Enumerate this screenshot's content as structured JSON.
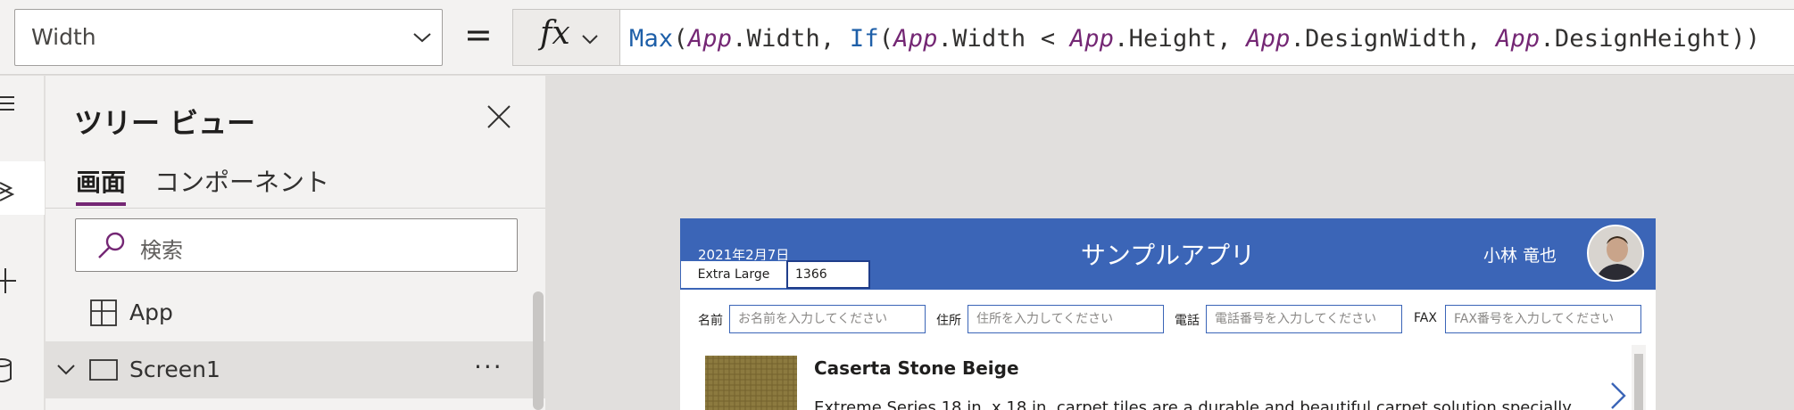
{
  "formula_bar": {
    "property": "Width",
    "equals": "=",
    "fx_label": "fx",
    "formula_tokens": [
      {
        "t": "Max",
        "k": "fn"
      },
      {
        "t": "(",
        "k": "pn"
      },
      {
        "t": "App",
        "k": "kw"
      },
      {
        "t": ".Width, ",
        "k": "pn"
      },
      {
        "t": "If",
        "k": "fn"
      },
      {
        "t": "(",
        "k": "pn"
      },
      {
        "t": "App",
        "k": "kw"
      },
      {
        "t": ".Width < ",
        "k": "pn"
      },
      {
        "t": "App",
        "k": "kw"
      },
      {
        "t": ".Height, ",
        "k": "pn"
      },
      {
        "t": "App",
        "k": "kw"
      },
      {
        "t": ".DesignWidth, ",
        "k": "pn"
      },
      {
        "t": "App",
        "k": "kw"
      },
      {
        "t": ".DesignHeight))",
        "k": "pn"
      }
    ]
  },
  "rail": {
    "icons": [
      "hamburger-menu-icon",
      "layers-icon",
      "insert-plus-icon",
      "data-cylinder-icon"
    ]
  },
  "tree_view": {
    "title": "ツリー ビュー",
    "tabs": [
      "画面",
      "コンポーネント"
    ],
    "search_placeholder": "検索",
    "nodes": [
      {
        "label": "App"
      },
      {
        "label": "Screen1",
        "more": "···"
      }
    ]
  },
  "app_preview": {
    "date": "2021年2月7日",
    "title": "サンプルアプリ",
    "user": "小林 竜也",
    "size_label": "Extra Large",
    "size_value": "1366",
    "fields": [
      {
        "label": "名前",
        "placeholder": "お名前を入力してください"
      },
      {
        "label": "住所",
        "placeholder": "住所を入力してください"
      },
      {
        "label": "電話",
        "placeholder": "電話番号を入力してください"
      },
      {
        "label": "FAX",
        "placeholder": "FAX番号を入力してください"
      }
    ],
    "product": {
      "name": "Caserta Stone Beige",
      "description": "Extreme Series 18 in. x 18 in. carpet tiles are a durable and beautiful carpet solution specially"
    }
  },
  "colors": {
    "accent": "#742774",
    "header_blue": "#3b65b7",
    "function_blue": "#1e5fa8"
  }
}
